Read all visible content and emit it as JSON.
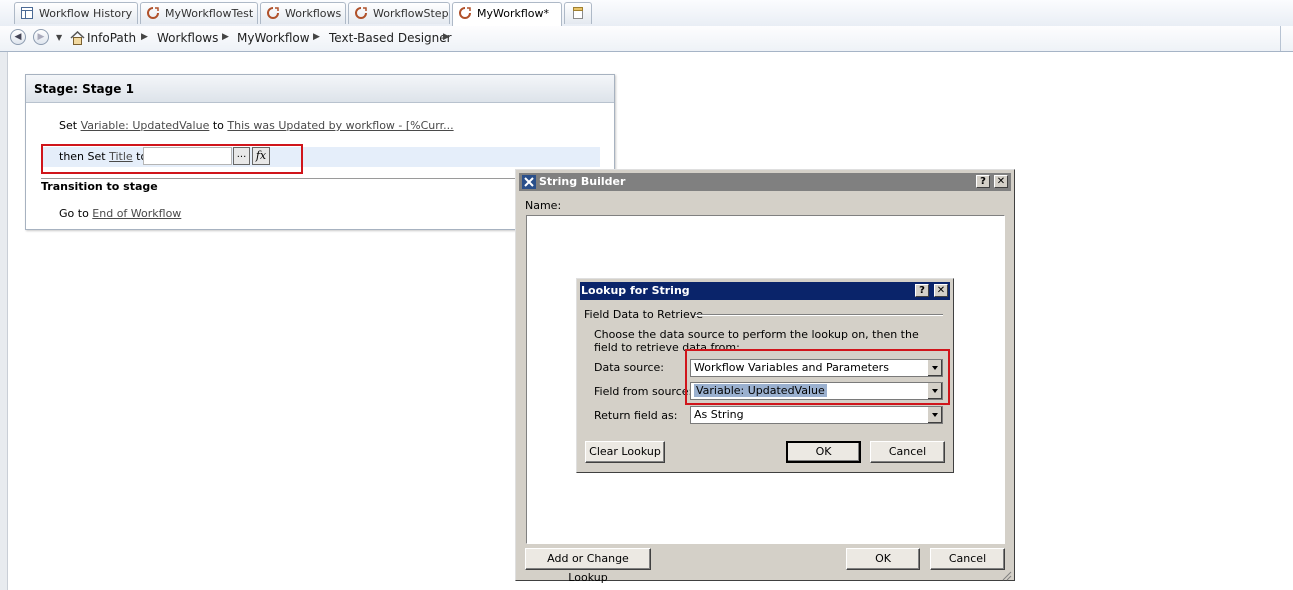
{
  "tabs": [
    {
      "label": "Workflow History",
      "icon": "list-icon"
    },
    {
      "label": "MyWorkflowTest",
      "icon": "workflow-icon"
    },
    {
      "label": "Workflows",
      "icon": "workflow-icon"
    },
    {
      "label": "WorkflowStep",
      "icon": "workflow-icon"
    },
    {
      "label": "MyWorkflow*",
      "icon": "workflow-icon",
      "active": true
    }
  ],
  "breadcrumb": {
    "items": [
      "InfoPath",
      "Workflows",
      "MyWorkflow",
      "Text-Based Designer"
    ]
  },
  "stage": {
    "title": "Stage: Stage 1",
    "line1": {
      "prefix": "Set",
      "var": "Variable: UpdatedValue",
      "mid": "to",
      "value": "This was Updated by workflow - [%Curr..."
    },
    "line2": {
      "prefix": "then Set",
      "field": "Title",
      "mid": "to",
      "browse": "...",
      "fx": "fx"
    },
    "transition_heading": "Transition to stage",
    "goto": {
      "prefix": "Go to",
      "target": "End of Workflow"
    }
  },
  "string_builder": {
    "title": "String Builder",
    "help": "?",
    "close": "✕",
    "name_label": "Name:",
    "add_lookup_button": "Add or Change Lookup",
    "ok_button": "OK",
    "cancel_button": "Cancel"
  },
  "lookup": {
    "title": "Lookup for String",
    "help": "?",
    "close": "✕",
    "group_label": "Field Data to Retrieve",
    "description": "Choose the data source to perform the lookup on, then the field to retrieve data from:",
    "data_source_label": "Data source:",
    "data_source_value": "Workflow Variables and Parameters",
    "field_label": "Field from source:",
    "field_value": "Variable: UpdatedValue",
    "return_label": "Return field as:",
    "return_value": "As String",
    "clear_button": "Clear Lookup",
    "ok_button": "OK",
    "cancel_button": "Cancel"
  },
  "colors": {
    "highlight_red": "#d0151b",
    "dialog_title": "#0a246a",
    "dialog_title_inactive": "#808080"
  }
}
